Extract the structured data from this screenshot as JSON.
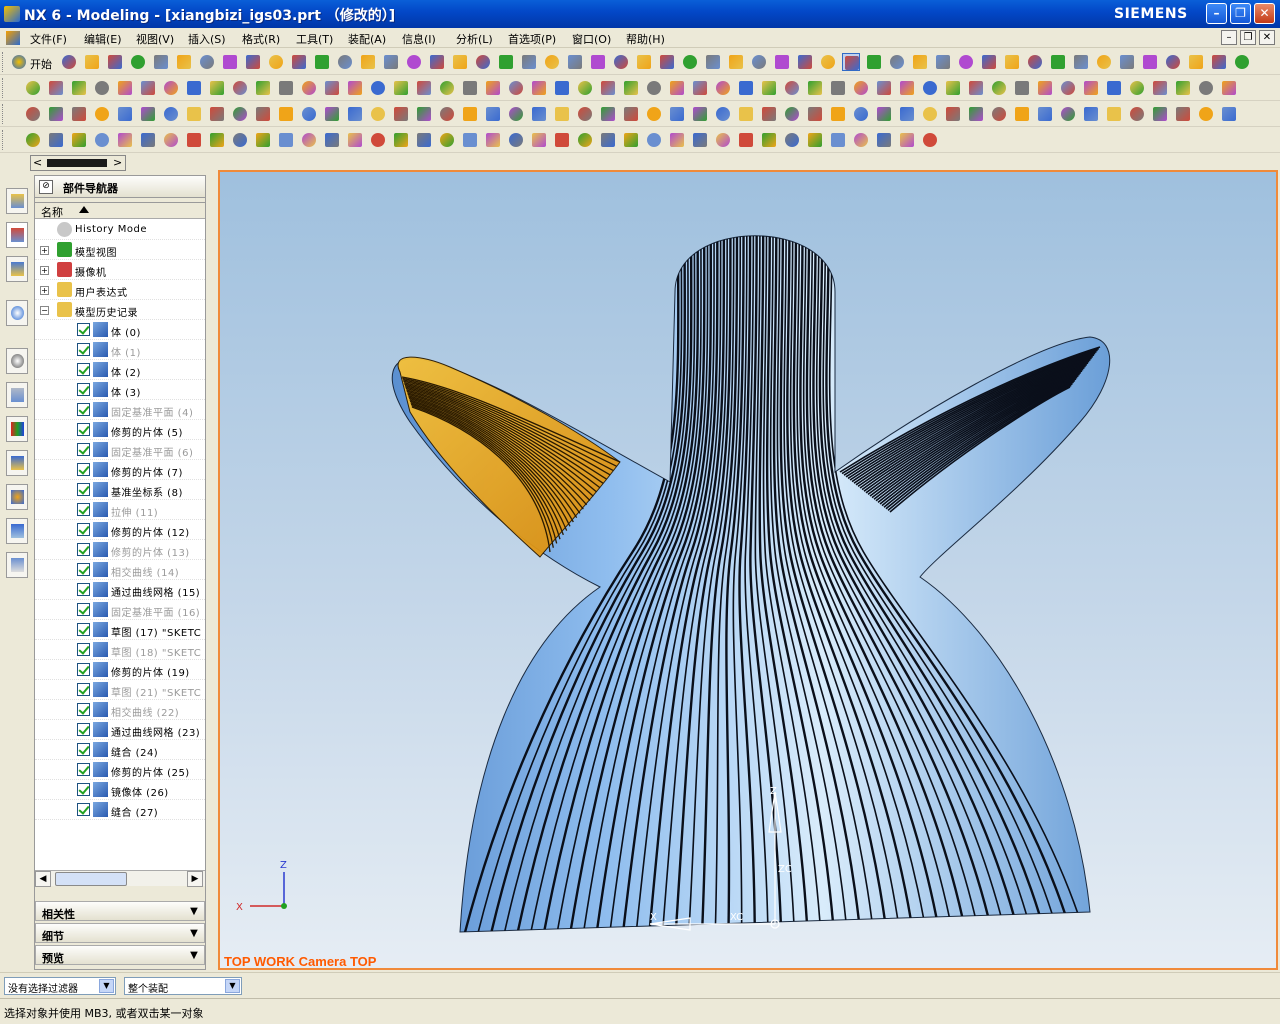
{
  "window": {
    "title": "NX 6 - Modeling - [xiangbizi_igs03.prt （修改的）]",
    "brand": "SIEMENS",
    "minimize": "–",
    "maximize": "❐",
    "close": "✕"
  },
  "menubar": {
    "items": [
      "文件(F)",
      "编辑(E)",
      "视图(V)",
      "插入(S)",
      "格式(R)",
      "工具(T)",
      "装配(A)",
      "信息(I)",
      "分析(L)",
      "首选项(P)",
      "窗口(O)",
      "帮助(H)"
    ],
    "mdi_min": "–",
    "mdi_restore": "❐",
    "mdi_close": "✕"
  },
  "toolbar1": {
    "start_label": "开始"
  },
  "navigator": {
    "title": "部件导航器",
    "column_name": "名称",
    "items": [
      {
        "label": "History Mode"
      },
      {
        "label": "模型视图"
      },
      {
        "label": "摄像机"
      },
      {
        "label": "用户表达式"
      },
      {
        "label": "模型历史记录"
      },
      {
        "label": "体 (0)"
      },
      {
        "label": "体 (1)"
      },
      {
        "label": "体 (2)"
      },
      {
        "label": "体 (3)"
      },
      {
        "label": "固定基准平面 (4)"
      },
      {
        "label": "修剪的片体 (5)"
      },
      {
        "label": "固定基准平面 (6)"
      },
      {
        "label": "修剪的片体 (7)"
      },
      {
        "label": "基准坐标系 (8)"
      },
      {
        "label": "拉伸 (11)"
      },
      {
        "label": "修剪的片体 (12)"
      },
      {
        "label": "修剪的片体 (13)"
      },
      {
        "label": "相交曲线 (14)"
      },
      {
        "label": "通过曲线网格 (15)"
      },
      {
        "label": "固定基准平面 (16)"
      },
      {
        "label": "草图 (17) \"SKETC"
      },
      {
        "label": "草图 (18) \"SKETC"
      },
      {
        "label": "修剪的片体 (19)"
      },
      {
        "label": "草图 (21) \"SKETC"
      },
      {
        "label": "相交曲线 (22)"
      },
      {
        "label": "通过曲线网格 (23)"
      },
      {
        "label": "缝合 (24)"
      },
      {
        "label": "修剪的片体 (25)"
      },
      {
        "label": "镜像体 (26)"
      },
      {
        "label": "缝合 (27)"
      }
    ],
    "panels": [
      "相关性",
      "细节",
      "预览"
    ]
  },
  "viewport": {
    "caption": "TOP WORK Camera TOP",
    "triad": {
      "z": "Z",
      "x": "X"
    },
    "wcs": {
      "z": "Z",
      "zc": "ZC",
      "xc": "XC",
      "x": "X"
    }
  },
  "statusbar": {
    "filter": "没有选择过滤器",
    "scope": "整个装配"
  },
  "prompt": "选择对象并使用 MB3, 或者双击某一对象",
  "colors": {
    "title_blue": "#0348c8",
    "viewport_border": "#f08a3a",
    "surface_blue": "#7fb2e6",
    "highlight_orange": "#f0a418",
    "caption_orange": "#ff5a00"
  }
}
